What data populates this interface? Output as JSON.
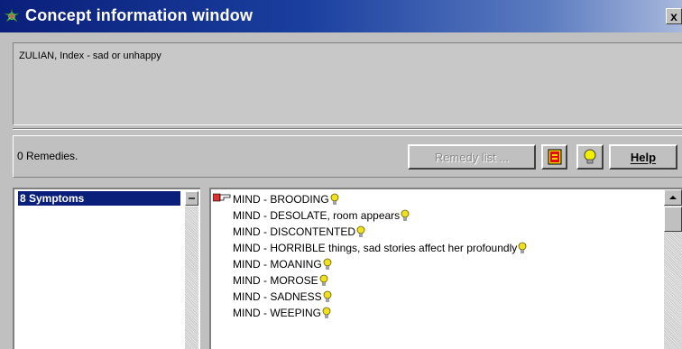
{
  "window": {
    "title": "Concept information window",
    "close_label": "x",
    "icon": "app-icon"
  },
  "concept": {
    "text": "ZULIAN, Index - sad or unhappy"
  },
  "remedies": {
    "count_label": "0 Remedies.",
    "remedy_list_label": "Remedy list ...",
    "help_label": "Help",
    "icons": [
      "red-book-icon",
      "lightbulb-icon"
    ]
  },
  "symptoms": {
    "header": "8 Symptoms",
    "items": [
      {
        "label": "MIND - BROODING"
      },
      {
        "label": "MIND - DESOLATE, room appears"
      },
      {
        "label": "MIND - DISCONTENTED"
      },
      {
        "label": "MIND - HORRIBLE things, sad stories affect her profoundly"
      },
      {
        "label": "MIND - MOANING"
      },
      {
        "label": "MIND - MOROSE"
      },
      {
        "label": "MIND - SADNESS"
      },
      {
        "label": "MIND - WEEPING"
      }
    ]
  },
  "colors": {
    "title_bar": "#0a1f7a",
    "selection": "#0a1f7a",
    "bulb": "#f0e020"
  }
}
